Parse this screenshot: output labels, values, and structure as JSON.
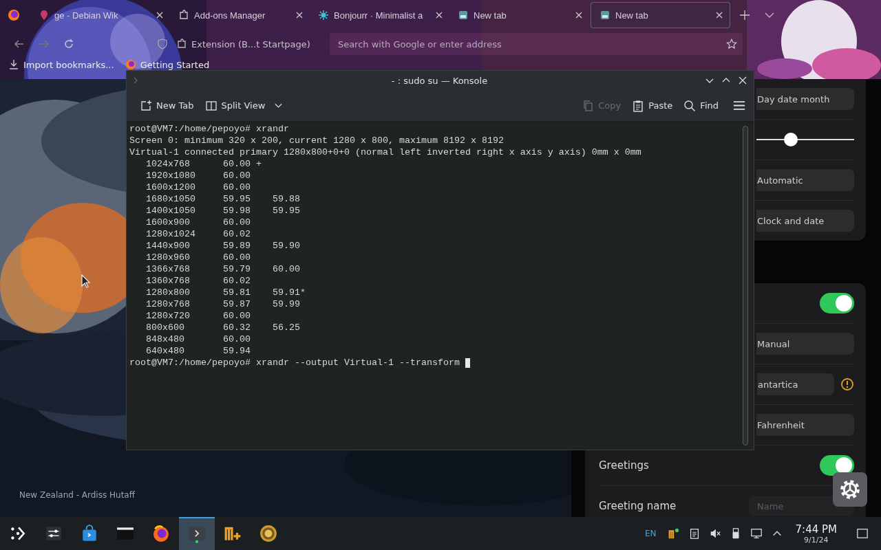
{
  "browser": {
    "tabs": [
      {
        "label": "ge - Debian Wik",
        "selected": false
      },
      {
        "label": "Add-ons Manager",
        "selected": false
      },
      {
        "label": "Bonjourr · Minimalist a",
        "selected": false
      },
      {
        "label": "New tab",
        "selected": false
      },
      {
        "label": "New tab",
        "selected": true
      }
    ],
    "identity": "Extension (B...t Startpage)",
    "address": {
      "placeholder": "Search with Google or enter address"
    },
    "bookmarks": [
      "Import bookmarks...",
      "Getting Started"
    ]
  },
  "page": {
    "credit": "New Zealand - Ardiss Hutaff",
    "cards": [
      {
        "rows": [
          {
            "kind": "select",
            "value": "Day date month"
          },
          {
            "kind": "slider",
            "level": 0.35
          },
          {
            "kind": "select",
            "value": "Automatic"
          },
          {
            "kind": "select",
            "value": "Clock and date"
          }
        ]
      },
      {
        "rows": [
          {
            "kind": "toggle",
            "on": true
          },
          {
            "kind": "select",
            "value": "Manual"
          },
          {
            "kind": "select",
            "value": "antartica",
            "warning": true
          },
          {
            "kind": "select",
            "value": "Fahrenheit"
          },
          {
            "kind": "toggle",
            "label": "Greetings",
            "on": true
          },
          {
            "kind": "input",
            "label": "Greeting name",
            "placeholder": "Name"
          }
        ]
      }
    ]
  },
  "konsole": {
    "title": "- : sudo su — Konsole",
    "toolbar": [
      {
        "label": "New Tab",
        "disabled": false
      },
      {
        "label": "Split View",
        "disabled": false
      },
      {
        "label": "Copy",
        "disabled": true
      },
      {
        "label": "Paste",
        "disabled": false
      },
      {
        "label": "Find",
        "disabled": false
      }
    ],
    "lines": [
      "root@VM7:/home/pepoyo# xrandr",
      "Screen 0: minimum 320 x 200, current 1280 x 800, maximum 8192 x 8192",
      "Virtual-1 connected primary 1280x800+0+0 (normal left inverted right x axis y axis) 0mm x 0mm",
      "   1024x768      60.00 +",
      "   1920x1080     60.00",
      "   1600x1200     60.00",
      "   1680x1050     59.95    59.88",
      "   1400x1050     59.98    59.95",
      "   1600x900      60.00",
      "   1280x1024     60.02",
      "   1440x900      59.89    59.90",
      "   1280x960      60.00",
      "   1366x768      59.79    60.00",
      "   1360x768      60.02",
      "   1280x800      59.81    59.91*",
      "   1280x768      59.87    59.99",
      "   1280x720      60.00",
      "   800x600       60.32    56.25",
      "   848x480       60.00",
      "   640x480       59.94",
      "root@VM7:/home/pepoyo# xrandr --output Virtual-1 --transform "
    ]
  },
  "taskbar": {
    "apps": [
      {
        "active": false
      },
      {
        "active": false
      },
      {
        "active": false
      },
      {
        "active": false
      },
      {
        "active": false
      },
      {
        "active": true
      },
      {
        "active": false
      },
      {
        "active": false
      }
    ],
    "keyboard": "EN",
    "time": "7:44 PM",
    "date": "9/1/24"
  }
}
